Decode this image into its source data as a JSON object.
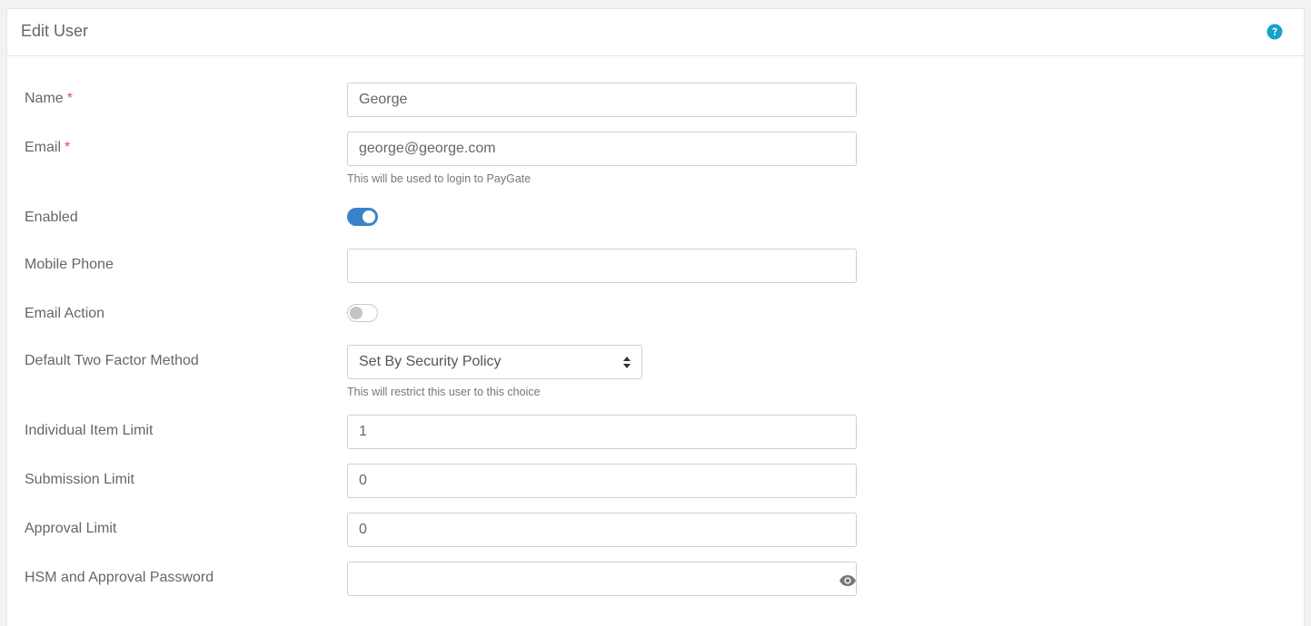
{
  "header": {
    "title": "Edit User",
    "help_icon": "question-circle-icon",
    "help_color": "#17a2c8"
  },
  "form": {
    "name": {
      "label": "Name",
      "required_mark": "*",
      "value": "George"
    },
    "email": {
      "label": "Email",
      "required_mark": "*",
      "value": "george@george.com",
      "help": "This will be used to login to PayGate"
    },
    "enabled": {
      "label": "Enabled",
      "checked": true
    },
    "mobile_phone": {
      "label": "Mobile Phone",
      "value": ""
    },
    "email_action": {
      "label": "Email Action",
      "checked": false
    },
    "two_factor": {
      "label": "Default Two Factor Method",
      "selected": "Set By Security Policy",
      "help": "This will restrict this user to this choice"
    },
    "individual_item_limit": {
      "label": "Individual Item Limit",
      "value": "1"
    },
    "submission_limit": {
      "label": "Submission Limit",
      "value": "0"
    },
    "approval_limit": {
      "label": "Approval Limit",
      "value": "0"
    },
    "hsm_password": {
      "label": "HSM and Approval Password",
      "value": "",
      "icon": "eye-icon"
    }
  },
  "colors": {
    "accent": "#3c82c8",
    "required": "#d9534f"
  }
}
